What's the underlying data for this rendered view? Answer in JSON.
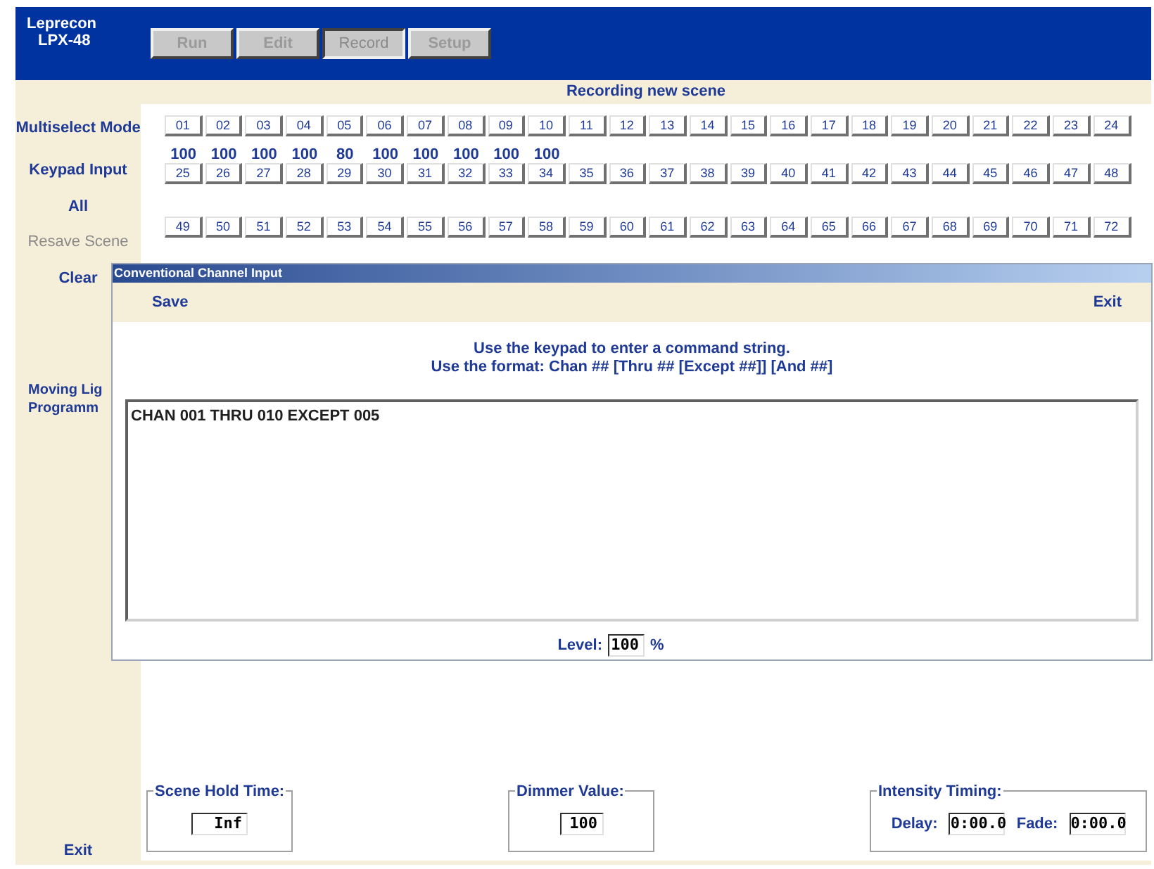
{
  "app": {
    "title_lines": [
      "Leprecon",
      "LPX-48"
    ]
  },
  "tabs": [
    {
      "label": "Run",
      "selected": false
    },
    {
      "label": "Edit",
      "selected": false
    },
    {
      "label": "Record",
      "selected": true
    },
    {
      "label": "Setup",
      "selected": false
    }
  ],
  "status": "Recording new scene",
  "sidebar": {
    "items": [
      {
        "label": "Multiselect Mode",
        "disabled": false
      },
      {
        "label": "Keypad Input",
        "disabled": false
      },
      {
        "label": "All",
        "disabled": false
      },
      {
        "label": "Resave Scene",
        "disabled": true
      },
      {
        "label": "Clear",
        "disabled": false
      },
      {
        "label": "Moving Lig\nProgramm",
        "disabled": false
      }
    ],
    "exit": "Exit"
  },
  "channel_rows": [
    {
      "buttons": [
        {
          "label": "01",
          "value": "100"
        },
        {
          "label": "02",
          "value": "100"
        },
        {
          "label": "03",
          "value": "100"
        },
        {
          "label": "04",
          "value": "100"
        },
        {
          "label": "05",
          "value": "80"
        },
        {
          "label": "06",
          "value": "100"
        },
        {
          "label": "07",
          "value": "100"
        },
        {
          "label": "08",
          "value": "100"
        },
        {
          "label": "09",
          "value": "100"
        },
        {
          "label": "10",
          "value": "100"
        },
        {
          "label": "11"
        },
        {
          "label": "12"
        },
        {
          "label": "13"
        },
        {
          "label": "14"
        },
        {
          "label": "15"
        },
        {
          "label": "16"
        },
        {
          "label": "17"
        },
        {
          "label": "18"
        },
        {
          "label": "19"
        },
        {
          "label": "20"
        },
        {
          "label": "21"
        },
        {
          "label": "22"
        },
        {
          "label": "23"
        },
        {
          "label": "24"
        }
      ]
    },
    {
      "buttons": [
        {
          "label": "25"
        },
        {
          "label": "26"
        },
        {
          "label": "27"
        },
        {
          "label": "28"
        },
        {
          "label": "29"
        },
        {
          "label": "30"
        },
        {
          "label": "31"
        },
        {
          "label": "32"
        },
        {
          "label": "33"
        },
        {
          "label": "34"
        },
        {
          "label": "35"
        },
        {
          "label": "36"
        },
        {
          "label": "37"
        },
        {
          "label": "38"
        },
        {
          "label": "39"
        },
        {
          "label": "40"
        },
        {
          "label": "41"
        },
        {
          "label": "42"
        },
        {
          "label": "43"
        },
        {
          "label": "44"
        },
        {
          "label": "45"
        },
        {
          "label": "46"
        },
        {
          "label": "47"
        },
        {
          "label": "48"
        }
      ]
    },
    {
      "buttons": [
        {
          "label": "49"
        },
        {
          "label": "50"
        },
        {
          "label": "51"
        },
        {
          "label": "52"
        },
        {
          "label": "53"
        },
        {
          "label": "54"
        },
        {
          "label": "55"
        },
        {
          "label": "56"
        },
        {
          "label": "57"
        },
        {
          "label": "58"
        },
        {
          "label": "59"
        },
        {
          "label": "60"
        },
        {
          "label": "61"
        },
        {
          "label": "62"
        },
        {
          "label": "63"
        },
        {
          "label": "64"
        },
        {
          "label": "65"
        },
        {
          "label": "66"
        },
        {
          "label": "67"
        },
        {
          "label": "68"
        },
        {
          "label": "69"
        },
        {
          "label": "70"
        },
        {
          "label": "71"
        },
        {
          "label": "72"
        }
      ]
    }
  ],
  "bottom": {
    "scene_hold_time": {
      "label": "Scene Hold Time:",
      "value": "Inf"
    },
    "dimmer_value": {
      "label": "Dimmer Value:",
      "value": "100"
    },
    "intensity_timing": {
      "label": "Intensity Timing:",
      "delay_label": "Delay:",
      "delay": "0:00.0",
      "fade_label": "Fade:",
      "fade": "0:00.0"
    }
  },
  "dialog": {
    "title": "Conventional Channel Input",
    "save": "Save",
    "exit": "Exit",
    "instructions": [
      "Use the keypad to enter a command string.",
      "Use the format: Chan ## [Thru ## [Except ##]] [And ##]"
    ],
    "command": "CHAN 001 THRU 010 EXCEPT 005",
    "level_label": "Level:",
    "level_value": "100",
    "level_unit": "%"
  }
}
